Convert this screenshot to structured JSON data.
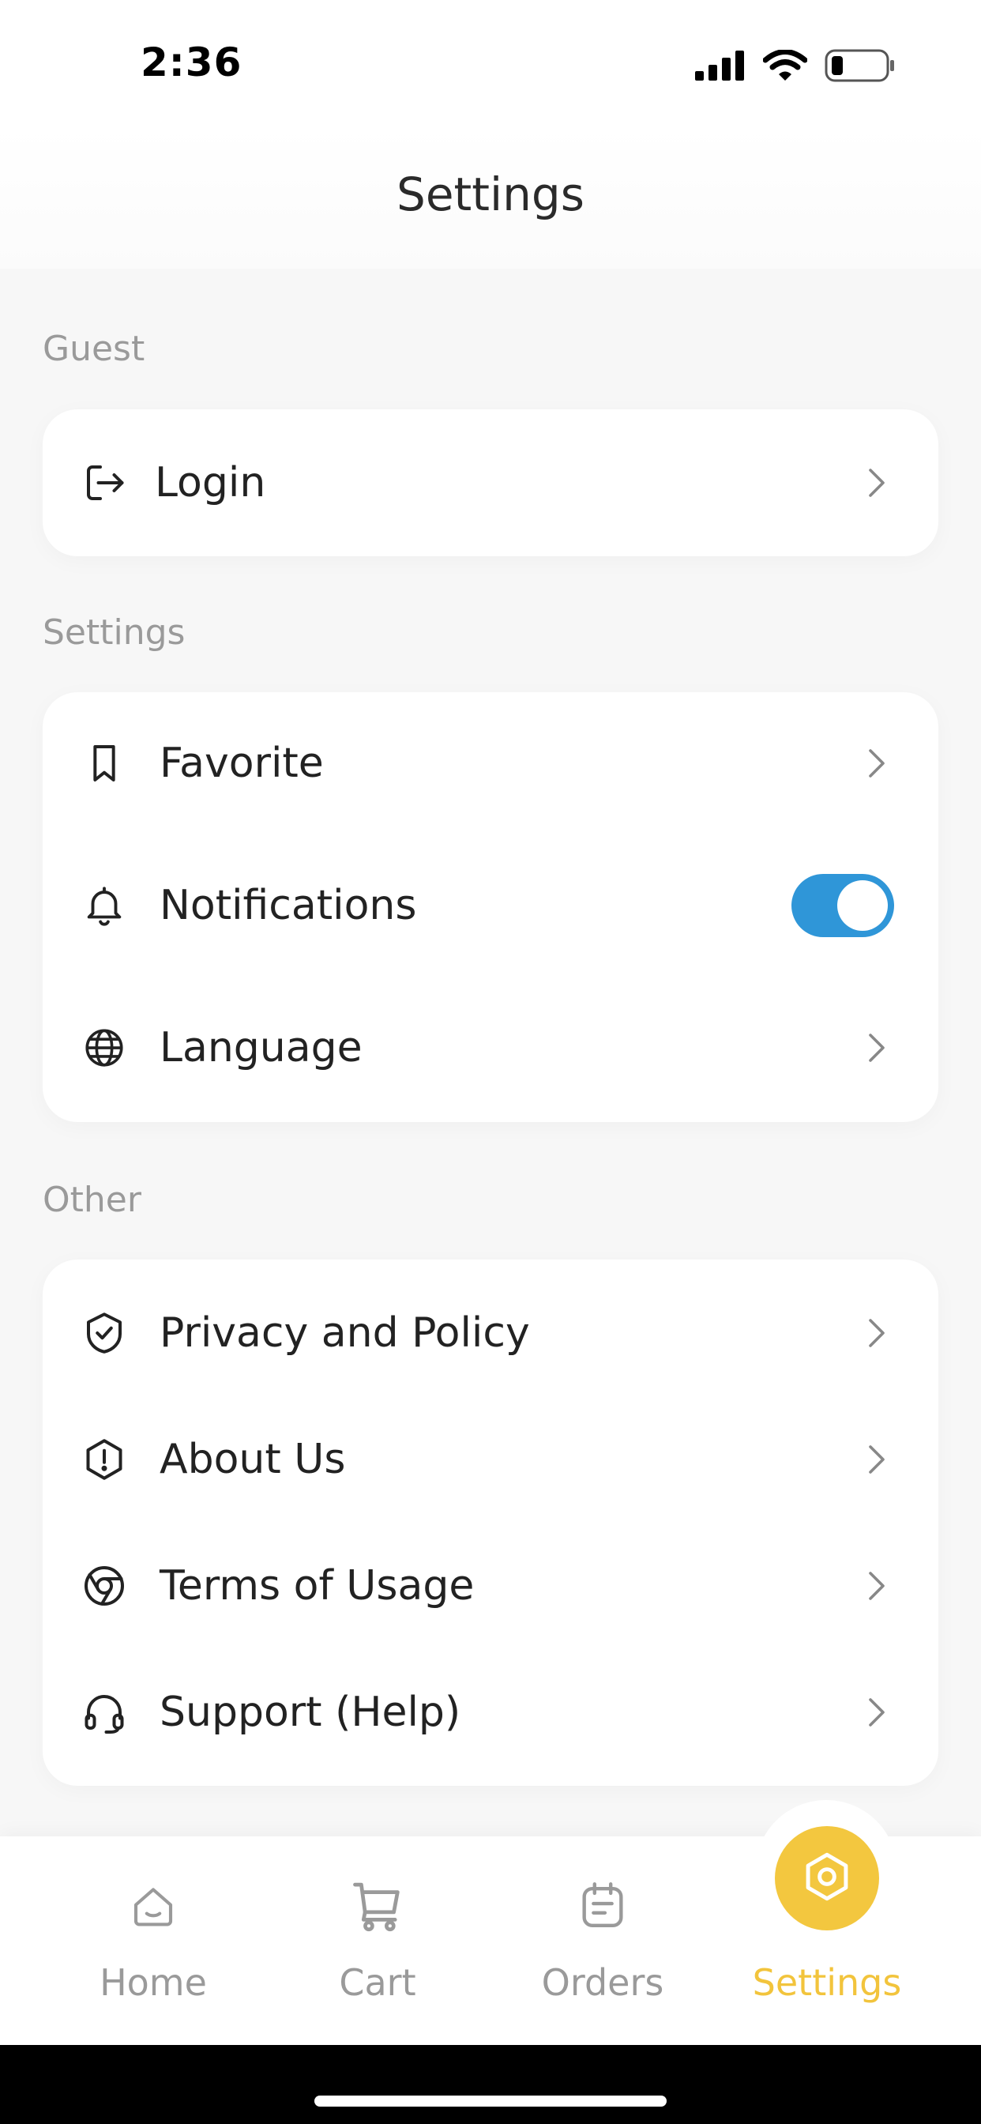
{
  "status_bar": {
    "time": "2:36"
  },
  "header": {
    "title": "Settings"
  },
  "sections": {
    "guest": {
      "label": "Guest",
      "items": [
        {
          "label": "Login",
          "icon": "login-icon"
        }
      ]
    },
    "settings": {
      "label": "Settings",
      "items": [
        {
          "label": "Favorite",
          "icon": "bookmark-icon"
        },
        {
          "label": "Notifications",
          "icon": "bell-icon",
          "toggle_on": true
        },
        {
          "label": "Language",
          "icon": "globe-icon"
        }
      ]
    },
    "other": {
      "label": "Other",
      "items": [
        {
          "label": "Privacy and Policy",
          "icon": "shield-check-icon"
        },
        {
          "label": "About Us",
          "icon": "info-hexagon-icon"
        },
        {
          "label": "Terms of Usage",
          "icon": "chrome-icon"
        },
        {
          "label": "Support (Help)",
          "icon": "headset-icon"
        }
      ]
    }
  },
  "tabbar": {
    "items": [
      {
        "label": "Home",
        "icon": "home-icon"
      },
      {
        "label": "Cart",
        "icon": "cart-icon"
      },
      {
        "label": "Orders",
        "icon": "orders-icon"
      },
      {
        "label": "Settings",
        "icon": "settings-hex-icon",
        "active": true
      }
    ]
  },
  "colors": {
    "accent": "#f3c73f",
    "toggle": "#2f96d8",
    "section_label": "#9a9a9a",
    "background": "#f7f7f7"
  }
}
